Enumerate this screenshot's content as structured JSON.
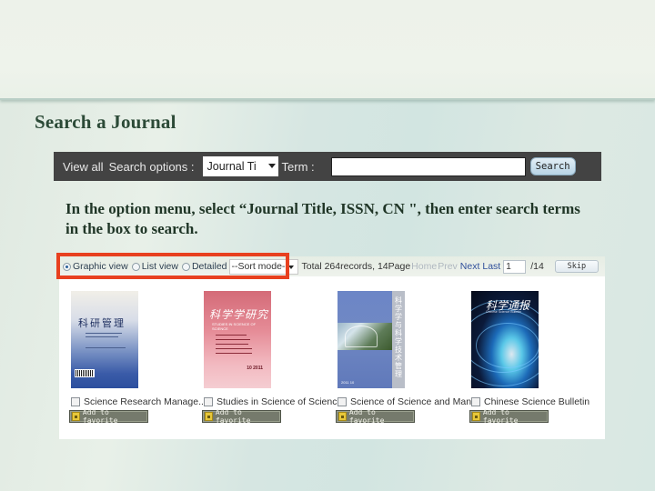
{
  "slide": {
    "title": "Search a Journal",
    "instruction": "In the option menu, select “Journal Title, ISSN, CN \", then enter search terms in the box to search."
  },
  "search_bar": {
    "view_all": "View all",
    "options_label": "Search options :",
    "option_selected": "Journal Ti",
    "term_label": "Term :",
    "term_value": "",
    "search_button": "Search"
  },
  "results_toolbar": {
    "views": [
      {
        "label": "Graphic view",
        "checked": true
      },
      {
        "label": "List view",
        "checked": false
      },
      {
        "label": "Detailed",
        "checked": false
      }
    ],
    "sort_selected": "--Sort mode--",
    "total_text": "Total 264records, 14Page",
    "nav_home": "Home",
    "nav_prev": "Prev",
    "nav_next": "Next",
    "nav_last": "Last",
    "page_value": "1",
    "page_total": "/14",
    "skip_button": "Skip",
    "highlight_color": "#e8401f"
  },
  "journals": [
    {
      "title": "Science Research Manage...",
      "cover_title": "科研管理",
      "favorite_label": "Add to favorite"
    },
    {
      "title": "Studies in Science of Science",
      "cover_title": "科学学研究",
      "cover_subtitle": "STUDIES IN SCIENCE OF SCIENCE",
      "cover_issue": "10 2011",
      "favorite_label": "Add to favorite"
    },
    {
      "title": "Science of Science and Man...",
      "cover_title": "科学学与科学技术管理",
      "cover_issue": "2011 10",
      "favorite_label": "Add to favorite"
    },
    {
      "title": "Chinese Science Bulletin",
      "cover_title": "科学通报",
      "cover_subtitle": "Chinese Science Bulletin",
      "favorite_label": "Add to favorite"
    }
  ]
}
